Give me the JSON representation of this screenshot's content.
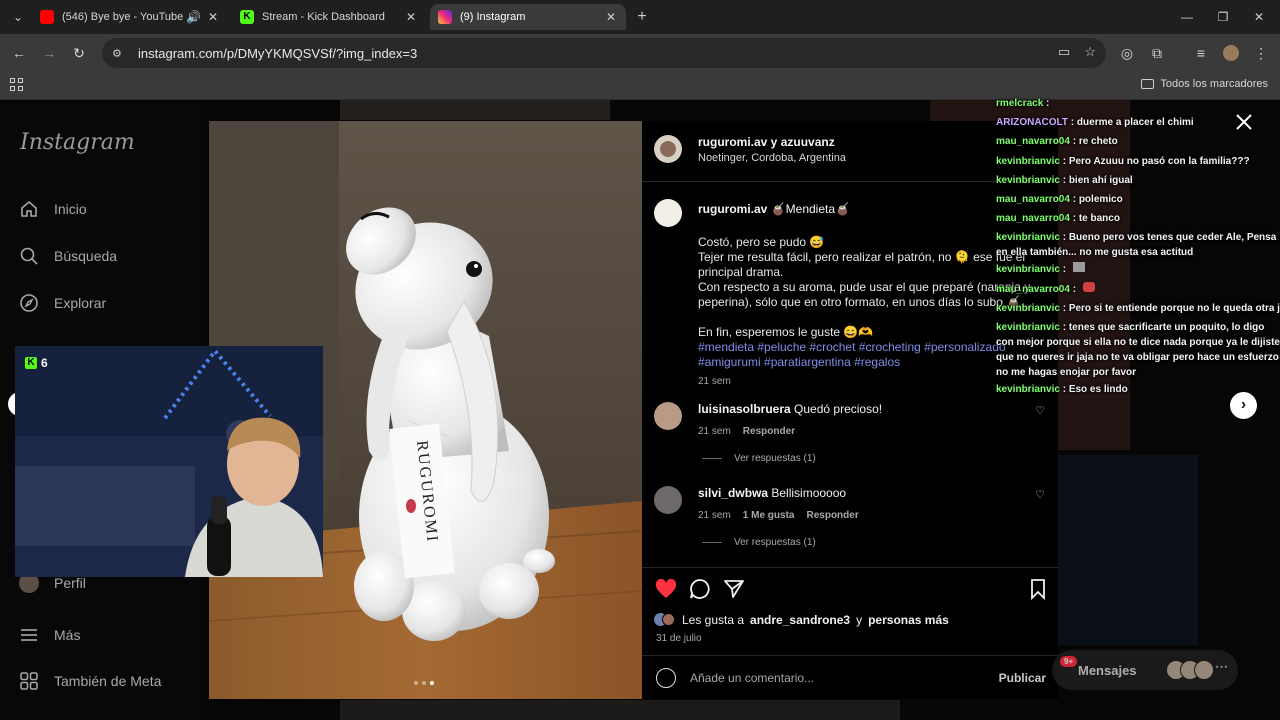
{
  "tabs": [
    {
      "title": "(546) Bye bye - YouTube",
      "icon": "youtube-icon",
      "color": "#ff0000"
    },
    {
      "title": "Stream - Kick Dashboard",
      "icon": "kick-icon",
      "color": "#53fc18"
    },
    {
      "title": "(9) Instagram",
      "icon": "instagram-icon",
      "color": "#e1306c",
      "active": true
    }
  ],
  "address_bar": {
    "url": "instagram.com/p/DMyYKMQSVSf/?img_index=3"
  },
  "bookmarks": {
    "all_label": "Todos los marcadores"
  },
  "instagram": {
    "logo": "Instagram",
    "nav": [
      "Inicio",
      "Búsqueda",
      "Explorar",
      "Perfil",
      "Más",
      "También de Meta"
    ]
  },
  "post": {
    "header": {
      "authors": "ruguromi.av y azuuvanz",
      "location": "Noetinger, Cordoba, Argentina"
    },
    "caption": {
      "user": "ruguromi.av",
      "title": "🧉Mendieta🧉",
      "text": "Costó, pero se pudo 😅\nTejer me resulta fácil, pero realizar el patrón, no 🫠 ese fue el principal drama.\nCon respecto a su aroma, pude usar el que preparé (naranja y peperina), sólo que en otro formato, en unos días lo subo 🧉\n\nEn fin, esperemos le guste 😄🫶",
      "hashtags": "#mendieta #peluche #crochet #crocheting #personalizado #amigurumi #paratiargentina #regalos",
      "time": "21 sem"
    },
    "comments": [
      {
        "user": "luisinasolbruera",
        "text": "Quedó precioso!",
        "time": "21 sem",
        "likes": "",
        "reply": "Responder",
        "view_replies": "Ver respuestas (1)"
      },
      {
        "user": "silvi_dwbwa",
        "text": "Bellisimooooo",
        "time": "21 sem",
        "likes": "1 Me gusta",
        "reply": "Responder",
        "view_replies": "Ver respuestas (1)"
      }
    ],
    "likes": {
      "prefix": "Les gusta a",
      "user": "andre_sandrone3",
      "joiner": "y",
      "suffix": "personas más"
    },
    "date": "31 de julio",
    "comment_placeholder": "Añade un comentario...",
    "publish_label": "Publicar",
    "image_tag_text": "RUGUROMI"
  },
  "messages": {
    "label": "Mensajes",
    "badge": "9+"
  },
  "stream": {
    "viewer_count": "6"
  },
  "chat": [
    {
      "user": "rmelcrack",
      "msg": "",
      "user_color": "#7dff6c"
    },
    {
      "user": "ARIZONACOLT",
      "msg": "duerme a placer el chimi",
      "user_color": "#c8a8ff"
    },
    {
      "user": "mau_navarro04",
      "msg": "re cheto",
      "user_color": "#7dff6c"
    },
    {
      "user": "kevinbrianvic",
      "msg": "Pero Azuuu no pasó con la familia???",
      "user_color": "#7dff6c"
    },
    {
      "user": "kevinbrianvic",
      "msg": "bien ahí igual",
      "user_color": "#7dff6c"
    },
    {
      "user": "mau_navarro04",
      "msg": "polemico",
      "user_color": "#7dff6c"
    },
    {
      "user": "mau_navarro04",
      "msg": "te banco",
      "user_color": "#7dff6c"
    },
    {
      "user": "kevinbrianvic",
      "msg": "Bueno pero vos tenes que ceder Ale, Pensa en ella también... no me gusta esa actitud",
      "user_color": "#7dff6c",
      "wrap": true
    },
    {
      "user": "kevinbrianvic",
      "msg": "",
      "user_color": "#7dff6c"
    },
    {
      "user": "mau_navarro04",
      "msg": "",
      "user_color": "#7dff6c"
    },
    {
      "user": "kevinbrianvic",
      "msg": "Pero si te entiende porque no le queda otra ja",
      "user_color": "#7dff6c"
    },
    {
      "user": "kevinbrianvic",
      "msg": "tenes que sacrificarte un poquito, lo digo con mejor porque si ella no te dice nada porque ya le dijiste que no queres ir jaja no te va obligar pero hace un esfuerzo no me hagas enojar por favor",
      "user_color": "#7dff6c",
      "wrap": true
    },
    {
      "user": "kevinbrianvic",
      "msg": "Eso es lindo",
      "user_color": "#7dff6c"
    }
  ]
}
